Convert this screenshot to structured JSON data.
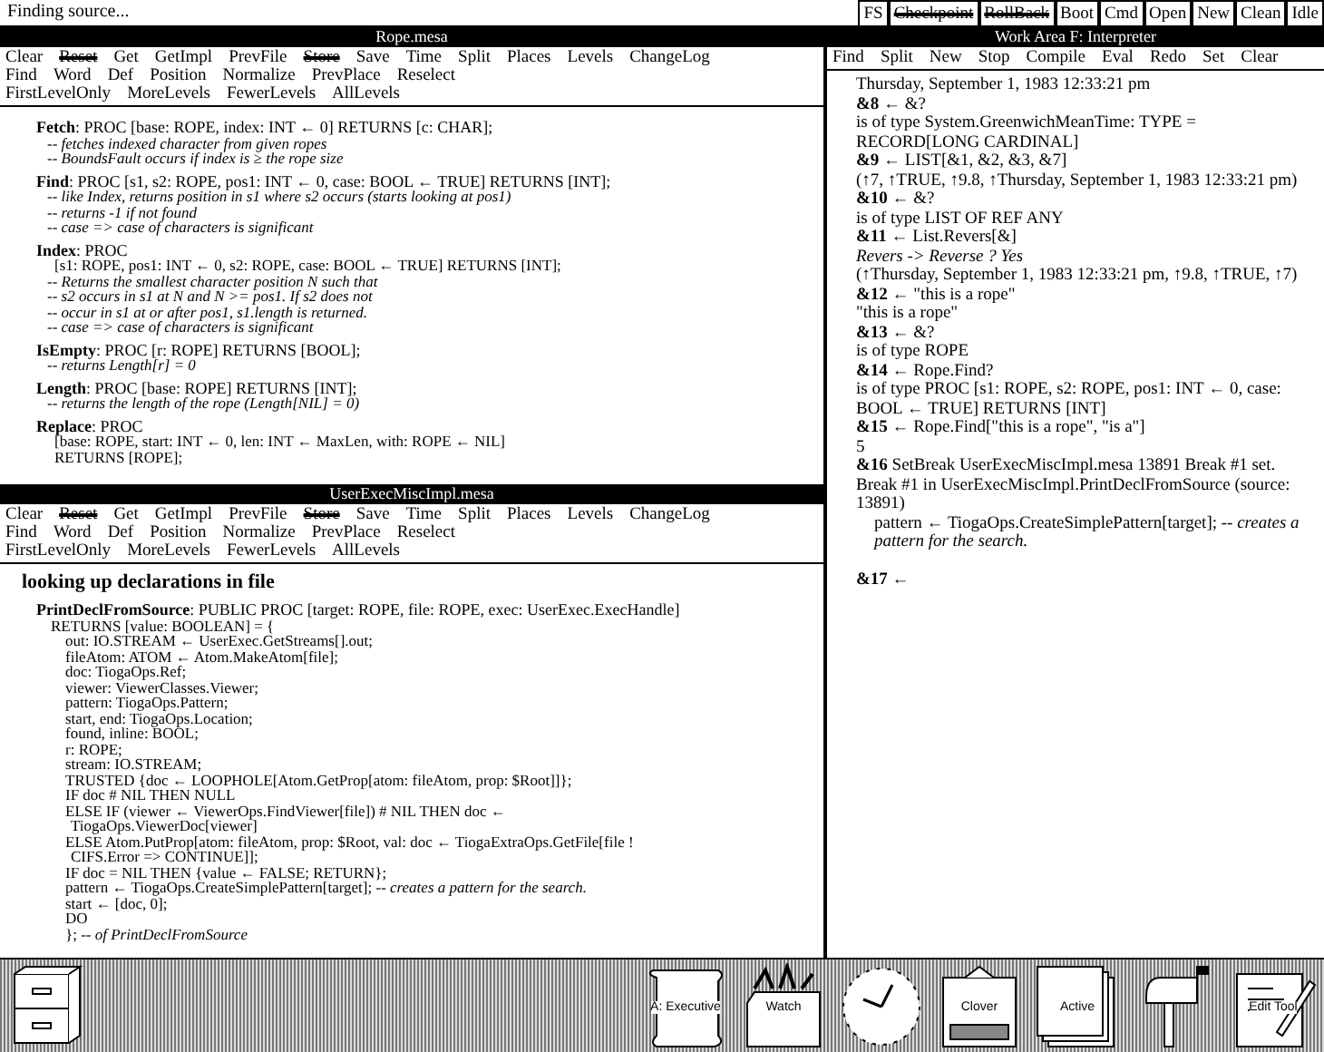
{
  "message_line": "Finding source...",
  "top_buttons": [
    {
      "label": "FS",
      "struck": false
    },
    {
      "label": "Checkpoint",
      "struck": true
    },
    {
      "label": "RollBack",
      "struck": true
    },
    {
      "label": "Boot",
      "struck": false
    },
    {
      "label": "Cmd",
      "struck": false
    },
    {
      "label": "Open",
      "struck": false
    },
    {
      "label": "New",
      "struck": false
    },
    {
      "label": "Clean",
      "struck": false
    },
    {
      "label": "Idle",
      "struck": false
    }
  ],
  "left_viewers": [
    {
      "title": "Rope.mesa",
      "menus": [
        [
          {
            "label": "Clear",
            "struck": false
          },
          {
            "label": "Reset",
            "struck": true
          },
          {
            "label": "Get",
            "struck": false
          },
          {
            "label": "GetImpl",
            "struck": false
          },
          {
            "label": "PrevFile",
            "struck": false
          },
          {
            "label": "Store",
            "struck": true
          },
          {
            "label": "Save",
            "struck": false
          },
          {
            "label": "Time",
            "struck": false
          },
          {
            "label": "Split",
            "struck": false
          },
          {
            "label": "Places",
            "struck": false
          },
          {
            "label": "Levels",
            "struck": false
          },
          {
            "label": "ChangeLog",
            "struck": false
          }
        ],
        [
          {
            "label": "Find",
            "struck": false
          },
          {
            "label": "Word",
            "struck": false
          },
          {
            "label": "Def",
            "struck": false
          },
          {
            "label": "Position",
            "struck": false
          },
          {
            "label": "Normalize",
            "struck": false
          },
          {
            "label": "PrevPlace",
            "struck": false
          },
          {
            "label": "Reselect",
            "struck": false
          }
        ],
        [
          {
            "label": "FirstLevelOnly",
            "struck": false
          },
          {
            "label": "MoreLevels",
            "struck": false
          },
          {
            "label": "FewerLevels",
            "struck": false
          },
          {
            "label": "AllLevels",
            "struck": false
          }
        ]
      ],
      "lines": [
        {
          "kind": "head",
          "text": "**Fetch**: PROC [base: ROPE, index: INT ← 0] RETURNS [c: CHAR];"
        },
        {
          "kind": "comment",
          "text": "-- fetches indexed character from given ropes"
        },
        {
          "kind": "comment",
          "text": "-- BoundsFault occurs if index is ≥ the rope size"
        },
        {
          "kind": "head",
          "text": "**Find**: PROC [s1, s2: ROPE, pos1: INT ← 0, case: BOOL ← TRUE] RETURNS [INT];"
        },
        {
          "kind": "comment",
          "text": "-- like Index, returns position in s1 where s2 occurs (starts looking at pos1)"
        },
        {
          "kind": "comment",
          "text": "-- returns -1 if not found"
        },
        {
          "kind": "comment",
          "text": "-- case => case of characters is significant"
        },
        {
          "kind": "head",
          "text": "**Index**: PROC"
        },
        {
          "kind": "cont",
          "text": "[s1: ROPE, pos1: INT ← 0, s2: ROPE, case: BOOL ← TRUE] RETURNS [INT];"
        },
        {
          "kind": "comment",
          "text": "-- Returns the smallest character position N such that"
        },
        {
          "kind": "comment",
          "text": "-- s2 occurs in s1 at N and N >= pos1.  If s2 does not"
        },
        {
          "kind": "comment",
          "text": "-- occur in s1 at or after pos1, s1.length is returned."
        },
        {
          "kind": "comment",
          "text": "-- case => case of characters is significant"
        },
        {
          "kind": "head",
          "text": "**IsEmpty**: PROC [r: ROPE] RETURNS [BOOL];"
        },
        {
          "kind": "comment",
          "text": "-- returns Length[r] = 0"
        },
        {
          "kind": "head",
          "text": "**Length**: PROC [base: ROPE] RETURNS [INT];"
        },
        {
          "kind": "comment",
          "text": "-- returns the length of the rope (Length[NIL] = 0)"
        },
        {
          "kind": "head",
          "text": "**Replace**: PROC"
        },
        {
          "kind": "cont",
          "text": "[base: ROPE, start: INT ← 0, len: INT ← MaxLen, with: ROPE ← NIL]"
        },
        {
          "kind": "cont",
          "text": "RETURNS [ROPE];"
        }
      ]
    },
    {
      "title": "UserExecMiscImpl.mesa",
      "menus": [
        [
          {
            "label": "Clear",
            "struck": false
          },
          {
            "label": "Reset",
            "struck": true
          },
          {
            "label": "Get",
            "struck": false
          },
          {
            "label": "GetImpl",
            "struck": false
          },
          {
            "label": "PrevFile",
            "struck": false
          },
          {
            "label": "Store",
            "struck": true
          },
          {
            "label": "Save",
            "struck": false
          },
          {
            "label": "Time",
            "struck": false
          },
          {
            "label": "Split",
            "struck": false
          },
          {
            "label": "Places",
            "struck": false
          },
          {
            "label": "Levels",
            "struck": false
          },
          {
            "label": "ChangeLog",
            "struck": false
          }
        ],
        [
          {
            "label": "Find",
            "struck": false
          },
          {
            "label": "Word",
            "struck": false
          },
          {
            "label": "Def",
            "struck": false
          },
          {
            "label": "Position",
            "struck": false
          },
          {
            "label": "Normalize",
            "struck": false
          },
          {
            "label": "PrevPlace",
            "struck": false
          },
          {
            "label": "Reselect",
            "struck": false
          }
        ],
        [
          {
            "label": "FirstLevelOnly",
            "struck": false
          },
          {
            "label": "MoreLevels",
            "struck": false
          },
          {
            "label": "FewerLevels",
            "struck": false
          },
          {
            "label": "AllLevels",
            "struck": false
          }
        ]
      ],
      "lines": [
        {
          "kind": "heading",
          "text": "looking up declarations in file"
        },
        {
          "kind": "head",
          "text": "**PrintDeclFromSource**: PUBLIC PROC [target: ROPE, file: ROPE, exec: UserExec.ExecHandle]"
        },
        {
          "kind": "returns",
          "text": "RETURNS [value: BOOLEAN] = {"
        },
        {
          "kind": "body",
          "text": "out: IO.STREAM ← UserExec.GetStreams[].out;"
        },
        {
          "kind": "body",
          "text": "fileAtom: ATOM ← Atom.MakeAtom[file];"
        },
        {
          "kind": "body",
          "text": "doc: TiogaOps.Ref;"
        },
        {
          "kind": "body",
          "text": "viewer: ViewerClasses.Viewer;"
        },
        {
          "kind": "body",
          "text": "pattern: TiogaOps.Pattern;"
        },
        {
          "kind": "body",
          "text": "start, end: TiogaOps.Location;"
        },
        {
          "kind": "body",
          "text": "found, inline: BOOL;"
        },
        {
          "kind": "body",
          "text": "r: ROPE;"
        },
        {
          "kind": "body",
          "text": "stream: IO.STREAM;"
        },
        {
          "kind": "body",
          "text": "TRUSTED {doc ← LOOPHOLE[Atom.GetProp[atom: fileAtom, prop: $Root]]};"
        },
        {
          "kind": "body",
          "text": "IF doc # NIL THEN NULL"
        },
        {
          "kind": "body",
          "text": "ELSE IF (viewer ← ViewerOps.FindViewer[file]) # NIL THEN doc ←"
        },
        {
          "kind": "body2",
          "text": "TiogaOps.ViewerDoc[viewer]"
        },
        {
          "kind": "body",
          "text": "ELSE Atom.PutProp[atom: fileAtom, prop: $Root, val: doc ← TiogaExtraOps.GetFile[file !"
        },
        {
          "kind": "body2",
          "text": "CIFS.Error => CONTINUE]];"
        },
        {
          "kind": "body",
          "text": "IF doc = NIL THEN {value ← FALSE; RETURN};"
        },
        {
          "kind": "body",
          "text": "pattern ← TiogaOps.CreateSimplePattern[target]; *-- creates a pattern for the search.*"
        },
        {
          "kind": "body",
          "text": "start ← [doc, 0];"
        },
        {
          "kind": "body",
          "text": "DO"
        },
        {
          "kind": "body",
          "text": "}; *-- of PrintDeclFromSource*"
        }
      ]
    }
  ],
  "interpreter": {
    "title": "Work Area F: Interpreter",
    "menu": [
      {
        "label": "Find",
        "struck": false
      },
      {
        "label": "Split",
        "struck": false
      },
      {
        "label": "New",
        "struck": false
      },
      {
        "label": "Stop",
        "struck": false
      },
      {
        "label": "Compile",
        "struck": false
      },
      {
        "label": "Eval",
        "struck": false
      },
      {
        "label": "Redo",
        "struck": false
      },
      {
        "label": "Set",
        "struck": false
      },
      {
        "label": "Clear",
        "struck": false
      }
    ],
    "lines": [
      {
        "kind": "out",
        "text": "Thursday, September 1, 1983 12:33:21 pm"
      },
      {
        "kind": "out",
        "text": "**&8** ← &?"
      },
      {
        "kind": "out",
        "text": "is of type System.GreenwichMeanTime: TYPE = RECORD[LONG CARDINAL]"
      },
      {
        "kind": "out",
        "text": "**&9** ← LIST[&1, &2, &3, &7]"
      },
      {
        "kind": "out",
        "text": "(↑7, ↑TRUE, ↑9.8, ↑Thursday, September 1, 1983 12:33:21 pm)"
      },
      {
        "kind": "out",
        "text": "**&10** ← &?"
      },
      {
        "kind": "out",
        "text": "is of type LIST OF REF ANY"
      },
      {
        "kind": "out",
        "text": "**&11** ← List.Revers[&]"
      },
      {
        "kind": "out",
        "text": "*Revers -> Reverse ? Yes*"
      },
      {
        "kind": "out",
        "text": "(↑Thursday, September 1, 1983 12:33:21 pm, ↑9.8, ↑TRUE, ↑7)"
      },
      {
        "kind": "out",
        "text": "**&12** ← \"this is a rope\""
      },
      {
        "kind": "out",
        "text": "\"this is a rope\""
      },
      {
        "kind": "out",
        "text": "**&13** ← &?"
      },
      {
        "kind": "out",
        "text": "is of type ROPE"
      },
      {
        "kind": "out",
        "text": "**&14** ← Rope.Find?"
      },
      {
        "kind": "out",
        "text": "is of type PROC [s1: ROPE, s2: ROPE, pos1: INT ← 0, case: BOOL ← TRUE] RETURNS [INT]"
      },
      {
        "kind": "out",
        "text": "**&15** ← Rope.Find[\"this is a rope\", \"is a\"]"
      },
      {
        "kind": "out",
        "text": "5"
      },
      {
        "kind": "out",
        "text": "**&16** SetBreak UserExecMiscImpl.mesa 13891      Break #1 set."
      },
      {
        "kind": "out",
        "text": "Break #1 in UserExecMiscImpl.PrintDeclFromSource (source: 13891)"
      },
      {
        "kind": "indent",
        "text": "pattern ← TiogaOps.CreateSimplePattern[target]; *-- creates a pattern for the search.*"
      },
      {
        "kind": "spaced",
        "text": "**&17** ←"
      }
    ]
  },
  "desktop_icons": [
    {
      "kind": "drawer"
    },
    {
      "kind": "scroll",
      "label": "A: Executive"
    },
    {
      "kind": "toolbox",
      "label": "Watch"
    },
    {
      "kind": "clock"
    },
    {
      "kind": "typewriter",
      "label": "Clover"
    },
    {
      "kind": "document",
      "label": "Active"
    },
    {
      "kind": "mailbox"
    },
    {
      "kind": "notepad",
      "label": "Edit Tool"
    }
  ]
}
